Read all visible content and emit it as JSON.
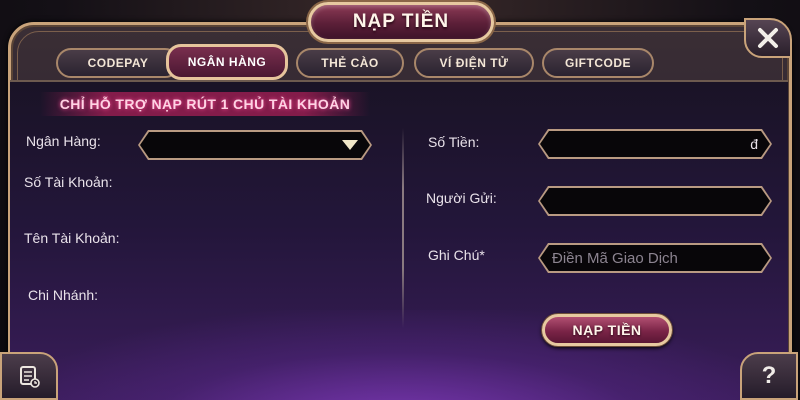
{
  "window": {
    "title": "NẠP TIỀN"
  },
  "tabs": [
    {
      "label": "CODEPAY",
      "active": false
    },
    {
      "label": "NGÂN HÀNG",
      "active": true
    },
    {
      "label": "THẺ CÀO",
      "active": false
    },
    {
      "label": "VÍ ĐIỆN TỬ",
      "active": false
    },
    {
      "label": "GIFTCODE",
      "active": false
    }
  ],
  "notice": "CHỈ HỖ TRỢ NẠP RÚT 1 CHỦ TÀI KHOẢN",
  "left_form": {
    "bank_label": "Ngân Hàng:",
    "account_number_label": "Số Tài Khoản:",
    "account_name_label": "Tên Tài Khoản:",
    "branch_label": "Chi Nhánh:"
  },
  "right_form": {
    "amount_label": "Số Tiền:",
    "amount_currency": "đ",
    "sender_label": "Người Gửi:",
    "note_label": "Ghi Chú*",
    "note_placeholder": "Điền Mã Giao Dịch"
  },
  "buttons": {
    "submit_label": "NẠP TIỀN",
    "help_label": "?"
  },
  "icons": {
    "close": "close-icon",
    "dropdown": "triangle-down-icon",
    "history": "scroll-history-icon",
    "help": "question-icon"
  },
  "colors": {
    "frame_gold": "#c9a37a",
    "title_plaque": "#7a2f4e",
    "notice_text": "#ffd3e4",
    "panel_bg": "#1a1326",
    "panel_glow": "#7c38b5"
  }
}
